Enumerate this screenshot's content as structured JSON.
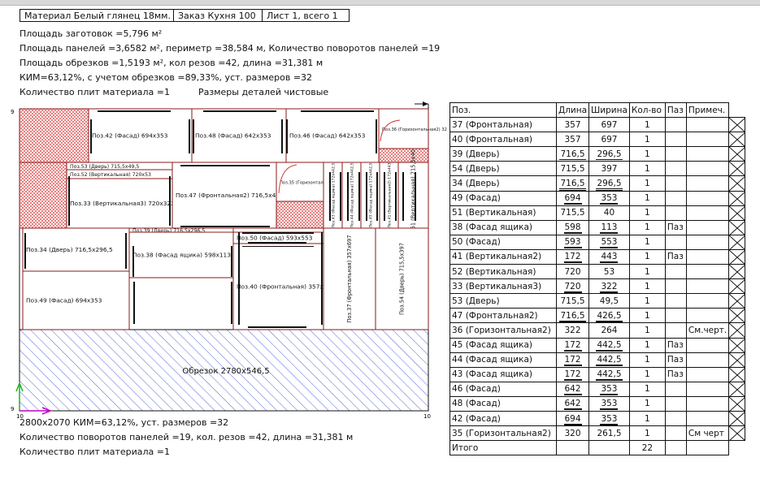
{
  "header": {
    "material": "Материал Белый глянец 18мм.",
    "order": "Заказ Кухня 100",
    "sheet": "Лист 1, всего 1"
  },
  "info_lines": [
    "Площадь заготовок =5,796 м²",
    "Площадь панелей =3,6582 м², периметр =38,584 м, Количество поворотов панелей =19",
    "Площадь обрезков =1,5193 м², кол резов =42, длина =31,381 м",
    "КИМ=63,12%, с учетом обрезков =89,33%, уст. размеров =32",
    "Количество плит материала =1",
    "Размеры деталей чистовые"
  ],
  "bottom_lines": [
    "2800x2070 КИМ=63,12%, уст. размеров =32",
    "Количество поворотов панелей =19, кол. резов =42, длина =31,381 м",
    "Количество плит материала =1"
  ],
  "sheet_marks": {
    "top_left": "9",
    "bottom_left": "9",
    "bottom_left_x": "10",
    "bottom_right": "10"
  },
  "colors": {
    "cut_line": "#8b1a1a",
    "waste_hatch": "#d63a3a",
    "offcut_hatch": "#2d3fcf",
    "axis_x": "#c000c0",
    "axis_y": "#20b020"
  },
  "panels": [
    {
      "label": "Поз.42 (Фасад) 694x353",
      "small": false
    },
    {
      "label": "Поз.48 (Фасад) 642x353",
      "small": false
    },
    {
      "label": "Поз.46 (Фасад) 642x353",
      "small": false
    },
    {
      "label": "Поз.36 (Горизонтальная2) 322x264",
      "small": true
    },
    {
      "label": "Поз.53 (Дверь) 715,5x49,5",
      "small": false
    },
    {
      "label": "Поз.52 (Вертикальная) 720x53",
      "small": false
    },
    {
      "label": "Поз.33 (Вертикальная3) 720x322",
      "small": false
    },
    {
      "label": "Поз.47 (Фронтальная2) 716,5x426,5",
      "small": false
    },
    {
      "label": "Поз.35 (Горизонтальная2) 320x261,5",
      "small": true
    },
    {
      "label": "Поз.43 (Фасад ящика) 172x442,5",
      "small": true
    },
    {
      "label": "Поз.44 (Фасад ящика) 172x442,5",
      "small": true
    },
    {
      "label": "Поз.45 (Фасад ящика) 172x442,5",
      "small": true
    },
    {
      "label": "Поз.41 (Вертикальная2) 172x443",
      "small": true
    },
    {
      "label": "Поз.51 (Вертикальная) 715,5x40",
      "small": false
    },
    {
      "label": "Поз.39 (Дверь) 716,5x296,5",
      "small": false
    },
    {
      "label": "Поз.34 (Дверь) 716,5x296,5",
      "small": false
    },
    {
      "label": "Поз.38 (Фасад ящика) 598x113",
      "small": false
    },
    {
      "label": "Поз.50 (Фасад) 593x553",
      "small": false
    },
    {
      "label": "Поз.40 (Фронтальная) 357x697",
      "small": false
    },
    {
      "label": "Поз.37 (Фронтальная) 357x697",
      "small": false
    },
    {
      "label": "Поз.54 (Дверь) 715,5x397",
      "small": false
    },
    {
      "label": "Поз.49 (Фасад) 694x353",
      "small": false
    }
  ],
  "offcut_label": "Обрезок 2780x546,5",
  "table": {
    "headers": [
      "Поз.",
      "Длина",
      "Ширина",
      "Кол-во",
      "Паз",
      "Примеч."
    ],
    "rows": [
      {
        "name": "37 (Фронтальная)",
        "len": "357",
        "wid": "697",
        "qty": "1",
        "paz": "",
        "note": "",
        "edge": "none"
      },
      {
        "name": "40 (Фронтальная)",
        "len": "357",
        "wid": "697",
        "qty": "1",
        "paz": "",
        "note": "",
        "edge": "none"
      },
      {
        "name": "39 (Дверь)",
        "len": "716,5",
        "wid": "296,5",
        "qty": "1",
        "paz": "",
        "note": "",
        "edge": "double"
      },
      {
        "name": "54 (Дверь)",
        "len": "715,5",
        "wid": "397",
        "qty": "1",
        "paz": "",
        "note": "",
        "edge": "none"
      },
      {
        "name": "34 (Дверь)",
        "len": "716,5",
        "wid": "296,5",
        "qty": "1",
        "paz": "",
        "note": "",
        "edge": "double"
      },
      {
        "name": "49 (Фасад)",
        "len": "694",
        "wid": "353",
        "qty": "1",
        "paz": "",
        "note": "",
        "edge": "single"
      },
      {
        "name": "51 (Вертикальная)",
        "len": "715,5",
        "wid": "40",
        "qty": "1",
        "paz": "",
        "note": "",
        "edge": "none"
      },
      {
        "name": "38 (Фасад ящика)",
        "len": "598",
        "wid": "113",
        "qty": "1",
        "paz": "Паз",
        "note": "",
        "edge": "single"
      },
      {
        "name": "50 (Фасад)",
        "len": "593",
        "wid": "553",
        "qty": "1",
        "paz": "",
        "note": "",
        "edge": "single"
      },
      {
        "name": "41 (Вертикальная2)",
        "len": "172",
        "wid": "443",
        "qty": "1",
        "paz": "Паз",
        "note": "",
        "edge": "single"
      },
      {
        "name": "52 (Вертикальная)",
        "len": "720",
        "wid": "53",
        "qty": "1",
        "paz": "",
        "note": "",
        "edge": "none"
      },
      {
        "name": "33 (Вертикальная3)",
        "len": "720",
        "wid": "322",
        "qty": "1",
        "paz": "",
        "note": "",
        "edge": "single"
      },
      {
        "name": "53 (Дверь)",
        "len": "715,5",
        "wid": "49,5",
        "qty": "1",
        "paz": "",
        "note": "",
        "edge": "none"
      },
      {
        "name": "47 (Фронтальная2)",
        "len": "716,5",
        "wid": "426,5",
        "qty": "1",
        "paz": "",
        "note": "",
        "edge": "single"
      },
      {
        "name": "36 (Горизонтальная2)",
        "len": "322",
        "wid": "264",
        "qty": "1",
        "paz": "",
        "note": "См.черт.",
        "edge": "none"
      },
      {
        "name": "45 (Фасад ящика)",
        "len": "172",
        "wid": "442,5",
        "qty": "1",
        "paz": "Паз",
        "note": "",
        "edge": "single"
      },
      {
        "name": "44 (Фасад ящика)",
        "len": "172",
        "wid": "442,5",
        "qty": "1",
        "paz": "Паз",
        "note": "",
        "edge": "single"
      },
      {
        "name": "43 (Фасад ящика)",
        "len": "172",
        "wid": "442,5",
        "qty": "1",
        "paz": "Паз",
        "note": "",
        "edge": "single"
      },
      {
        "name": "46 (Фасад)",
        "len": "642",
        "wid": "353",
        "qty": "1",
        "paz": "",
        "note": "",
        "edge": "single"
      },
      {
        "name": "48 (Фасад)",
        "len": "642",
        "wid": "353",
        "qty": "1",
        "paz": "",
        "note": "",
        "edge": "single"
      },
      {
        "name": "42 (Фасад)",
        "len": "694",
        "wid": "353",
        "qty": "1",
        "paz": "",
        "note": "",
        "edge": "single"
      },
      {
        "name": "35 (Горизонтальная2)",
        "len": "320",
        "wid": "261,5",
        "qty": "1",
        "paz": "",
        "note": "См черт",
        "edge": "none"
      }
    ],
    "total_label": "Итого",
    "total_qty": "22"
  }
}
